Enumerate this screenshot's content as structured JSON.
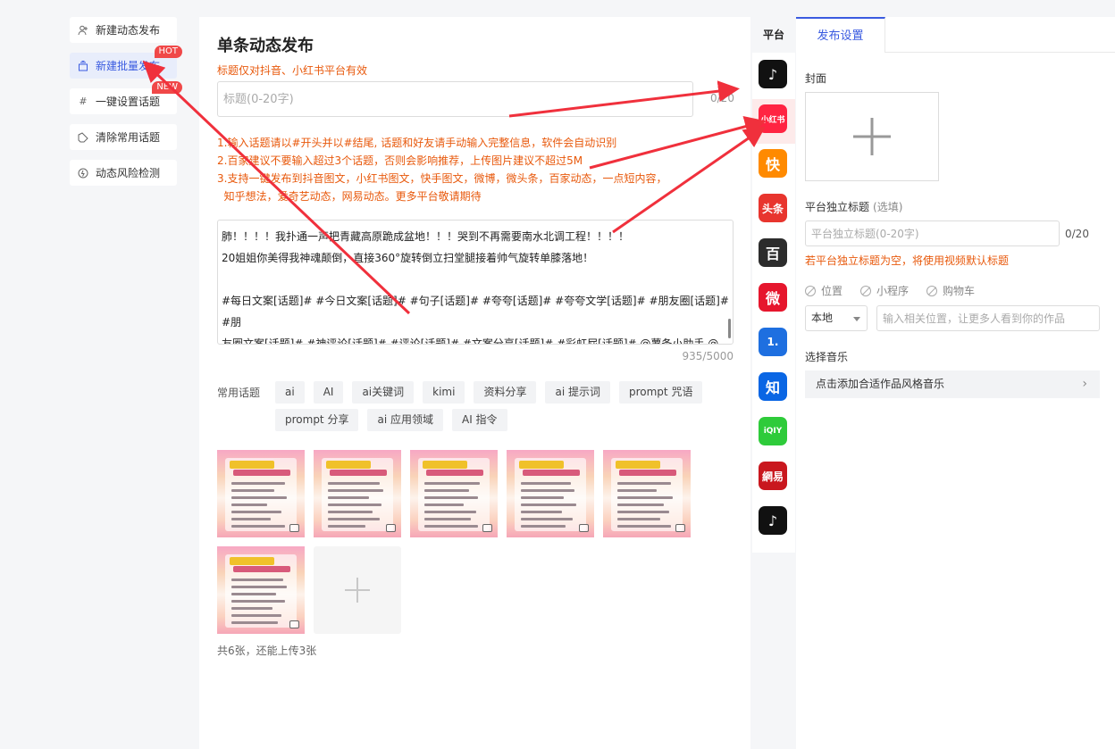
{
  "nav": [
    {
      "label": "新建动态发布",
      "icon": "person-plus-icon"
    },
    {
      "label": "新建批量发布",
      "icon": "batch-icon",
      "badge": "HOT",
      "active": true
    },
    {
      "label": "一键设置话题",
      "icon": "hashtag-icon",
      "badge": "NEW"
    },
    {
      "label": "清除常用话题",
      "icon": "eraser-icon"
    },
    {
      "label": "动态风险检测",
      "icon": "shield-check-icon"
    }
  ],
  "main": {
    "title": "单条动态发布",
    "subtitle": "标题仅对抖音、小红书平台有效",
    "title_placeholder": "标题(0-20字)",
    "title_count": "0/20",
    "notes": [
      "1.输入话题请以#开头并以#结尾, 话题和好友请手动输入完整信息，软件会自动识别",
      "2.百家建议不要输入超过3个话题，否则会影响推荐，上传图片建议不超过5M",
      "3.支持一键发布到抖音图文，小红书图文，快手图文，微博，微头条，百家动态，一点短内容，",
      "  知乎想法，爱奇艺动态，网易动态。更多平台敬请期待"
    ],
    "content": [
      "肺！！！！我扑通一声把青藏高原跪成盆地！！！哭到不再需要南水北调工程！！！！",
      "20姐姐你美得我神魂颠倒，直接360°旋转倒立扫堂腿接着帅气旋转单膝落地！",
      "",
      "#每日文案[话题]# #今日文案[话题]# #句子[话题]# #夸夸[话题]# #夸夸文学[话题]# #朋友圈[话题]# #朋",
      "友圈文案[话题]# #神评论[话题]# #评论[话题]# #文案分享[话题]# #彩虹屁[话题]# @薯条小助手 @薯队长"
    ],
    "content_count": "935/5000",
    "topics_label": "常用话题",
    "topics": [
      "ai",
      "AI",
      "ai关键词",
      "kimi",
      "资料分享",
      "ai 提示词",
      "prompt 咒语",
      "prompt 分享",
      "ai 应用领域",
      "AI 指令"
    ],
    "image_count_text": "共6张，还能上传3张"
  },
  "platforms": {
    "header": "平台",
    "items": [
      {
        "name": "抖音",
        "icon": "douyin-icon",
        "glyph": "♪",
        "color": "#111111"
      },
      {
        "name": "小红书",
        "icon": "xiaohongshu-icon",
        "glyph": "小红书",
        "color": "#ff2442"
      },
      {
        "name": "快手",
        "icon": "kuaishou-icon",
        "glyph": "快",
        "color": "#ff8a00"
      },
      {
        "name": "头条",
        "icon": "toutiao-icon",
        "glyph": "头条",
        "color": "#e8352e"
      },
      {
        "name": "百家号",
        "icon": "baijiahao-icon",
        "glyph": "百",
        "color": "#2c2c2c"
      },
      {
        "name": "微博",
        "icon": "weibo-icon",
        "glyph": "微",
        "color": "#e6162d"
      },
      {
        "name": "一点资讯",
        "icon": "yidian-icon",
        "glyph": "1.",
        "color": "#1e6fe0"
      },
      {
        "name": "知乎",
        "icon": "zhihu-icon",
        "glyph": "知",
        "color": "#0a66e4"
      },
      {
        "name": "爱奇艺",
        "icon": "iqiyi-icon",
        "glyph": "iQIY",
        "color": "#2ecb3a"
      },
      {
        "name": "网易",
        "icon": "netease-icon",
        "glyph": "網易",
        "color": "#c9171e"
      },
      {
        "name": "抖音2",
        "icon": "douyin-alt-icon",
        "glyph": "♪",
        "color": "#111111"
      }
    ]
  },
  "settings": {
    "tab": "发布设置",
    "cover_label": "封面",
    "title_label": "平台独立标题",
    "title_optional": "(选填)",
    "title_placeholder": "平台独立标题(0-20字)",
    "title_count": "0/20",
    "hint": "若平台独立标题为空，将使用视频默认标题",
    "options": [
      "位置",
      "小程序",
      "购物车"
    ],
    "location_select": "本地",
    "location_placeholder": "输入相关位置，让更多人看到你的作品",
    "music_label": "选择音乐",
    "music_button": "点击添加合适作品风格音乐"
  }
}
